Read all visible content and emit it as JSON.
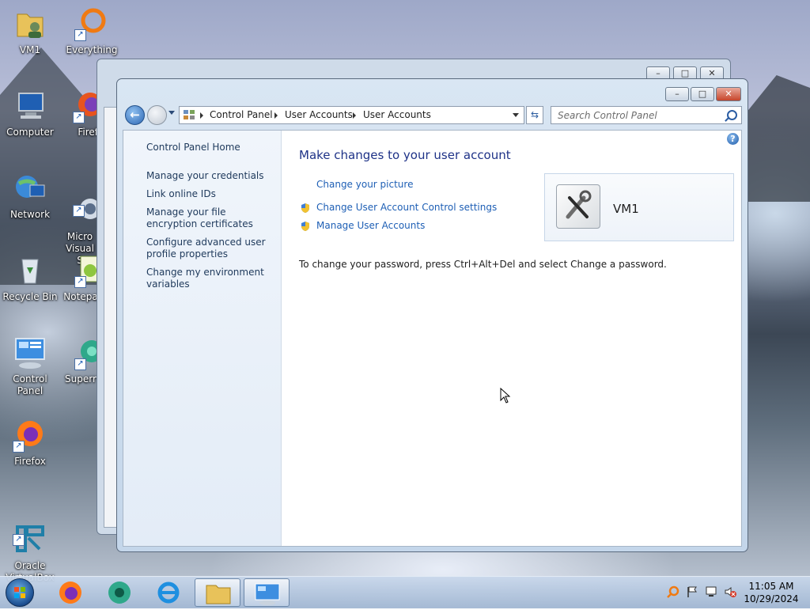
{
  "desktop": {
    "icons": [
      {
        "label": "VM1"
      },
      {
        "label": "Everything"
      },
      {
        "label": "Computer"
      },
      {
        "label": "Firef"
      },
      {
        "label": "Network"
      },
      {
        "label": "Micro\nVisual S"
      },
      {
        "label": "Recycle Bin"
      },
      {
        "label": "Notepa"
      },
      {
        "label": "Control Panel"
      },
      {
        "label": "Superr"
      },
      {
        "label": "Firefox"
      },
      {
        "label": "Oracle\nVirtualBox"
      }
    ]
  },
  "window": {
    "caption_buttons": {
      "minimize": "–",
      "maximize": "□",
      "close": "✕"
    },
    "address_bar": {
      "crumbs": [
        "Control Panel",
        "User Accounts",
        "User Accounts"
      ]
    },
    "search": {
      "placeholder": "Search Control Panel"
    },
    "left_pane": {
      "home": "Control Panel Home",
      "links": [
        "Manage your credentials",
        "Link online IDs",
        "Manage your file encryption certificates",
        "Configure advanced user profile properties",
        "Change my environment variables"
      ]
    },
    "main": {
      "heading": "Make changes to your user account",
      "tasks": [
        {
          "label": "Change your picture",
          "shield": false
        },
        {
          "label": "Change User Account Control settings",
          "shield": true
        },
        {
          "label": "Manage User Accounts",
          "shield": true
        }
      ],
      "user": {
        "name": "VM1"
      },
      "password_note": "To change your password, press Ctrl+Alt+Del and select Change a password."
    }
  },
  "taskbar": {
    "clock": {
      "time": "11:05 AM",
      "date": "10/29/2024"
    }
  }
}
